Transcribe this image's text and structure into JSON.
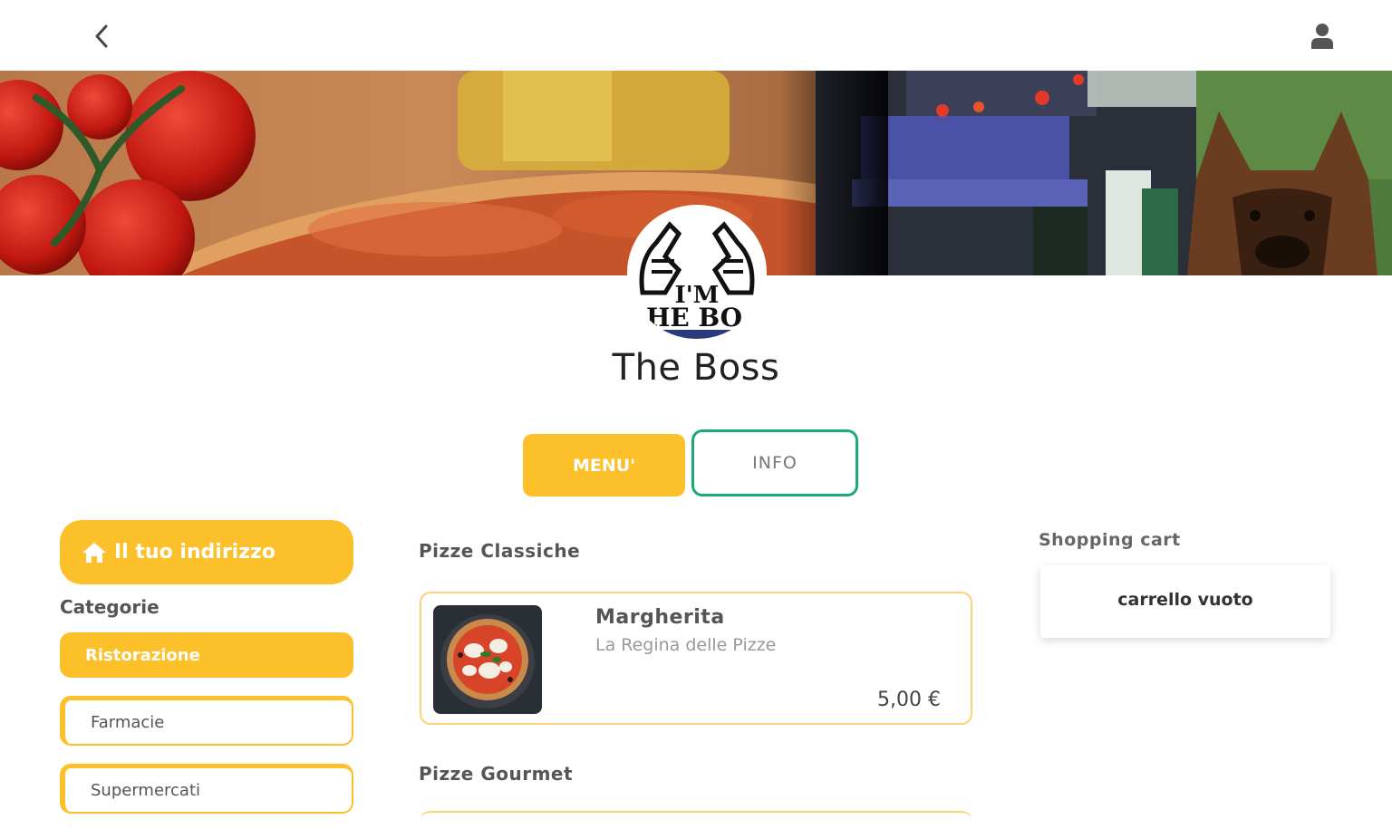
{
  "header": {
    "back_icon": "chevron-left-icon",
    "user_icon": "user-icon"
  },
  "store": {
    "name": "The Boss",
    "logo_text_line1": "I'M",
    "logo_text_line2": "HE BO"
  },
  "tabs": {
    "menu_label": "MENU'",
    "info_label": "INFO"
  },
  "sidebar": {
    "address_label": "Il tuo indirizzo",
    "address_icon": "home-icon",
    "categories_title": "Categorie",
    "categories": [
      {
        "label": "Ristorazione",
        "active": true
      },
      {
        "label": "Farmacie",
        "active": false
      },
      {
        "label": "Supermercati",
        "active": false
      }
    ]
  },
  "menu": {
    "sections": [
      {
        "title": "Pizze Classiche",
        "products": [
          {
            "name": "Margherita",
            "description": "La Regina delle Pizze",
            "price": "5,00 €"
          }
        ]
      },
      {
        "title": "Pizze Gourmet"
      }
    ]
  },
  "cart": {
    "title": "Shopping cart",
    "empty_text": "carrello vuoto"
  },
  "colors": {
    "accent": "#fcc02a",
    "info_border": "#1aa97b"
  }
}
